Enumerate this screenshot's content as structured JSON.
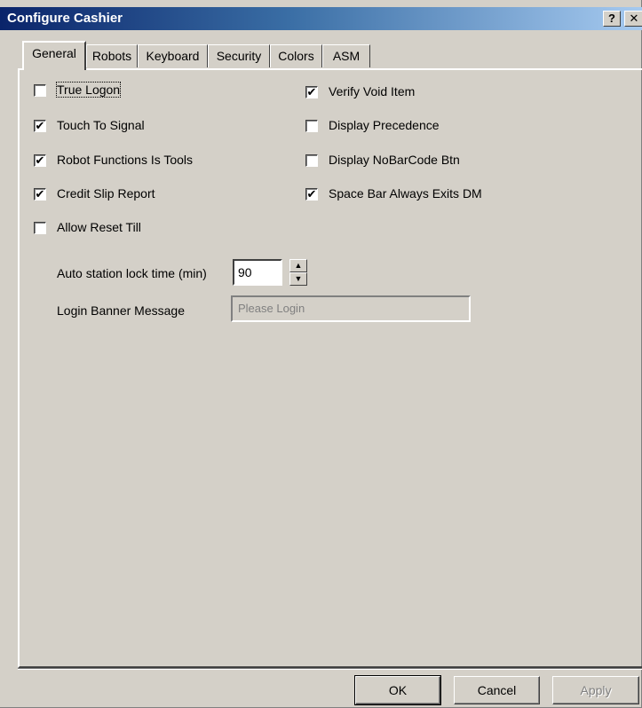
{
  "window": {
    "title": "Configure Cashier",
    "help_glyph": "?",
    "close_glyph": "✕"
  },
  "tabs": [
    {
      "label": "General",
      "active": true
    },
    {
      "label": "Robots",
      "active": false
    },
    {
      "label": "Keyboard",
      "active": false
    },
    {
      "label": "Security",
      "active": false
    },
    {
      "label": "Colors",
      "active": false
    },
    {
      "label": "ASM",
      "active": false
    }
  ],
  "general": {
    "left_checks": [
      {
        "label": "True Logon",
        "checked": false,
        "focused": true
      },
      {
        "label": "Touch To Signal",
        "checked": true
      },
      {
        "label": "Robot Functions Is Tools",
        "checked": true
      },
      {
        "label": "Credit Slip Report",
        "checked": true
      },
      {
        "label": "Allow Reset Till",
        "checked": false
      }
    ],
    "right_checks": [
      {
        "label": "Verify Void Item",
        "checked": true
      },
      {
        "label": "Display Precedence",
        "checked": false
      },
      {
        "label": "Display NoBarCode Btn",
        "checked": false
      },
      {
        "label": "Space Bar Always Exits DM",
        "checked": true
      }
    ],
    "lock_time_label": "Auto station lock time (min)",
    "lock_time_value": "90",
    "banner_label": "Login Banner Message",
    "banner_value": "Please Login"
  },
  "buttons": {
    "ok": "OK",
    "cancel": "Cancel",
    "apply": "Apply"
  },
  "check_mark": "✔",
  "colors": {
    "titlebar_start": "#0a246a",
    "titlebar_end": "#a6caf0",
    "face": "#d4d0c8"
  }
}
